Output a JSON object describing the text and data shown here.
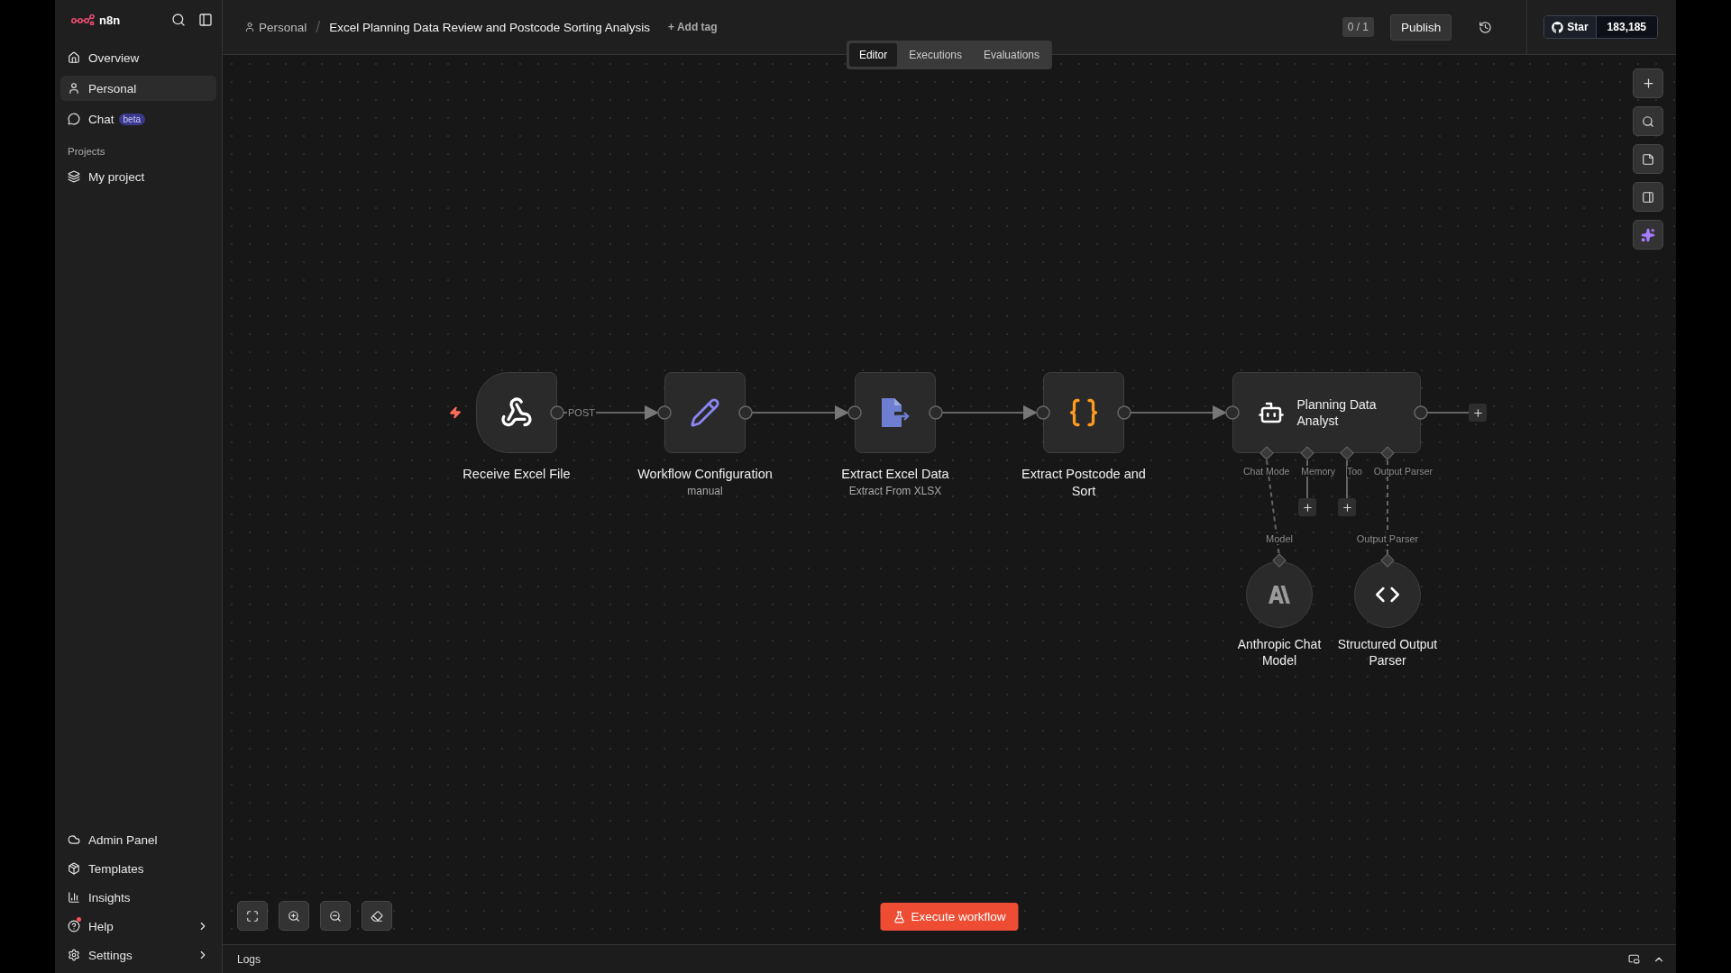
{
  "logo": {
    "text": "n8n"
  },
  "sidebar": {
    "items": [
      {
        "label": "Overview",
        "selected": false
      },
      {
        "label": "Personal",
        "selected": true
      },
      {
        "label": "Chat",
        "badge": "beta",
        "selected": false
      }
    ],
    "projects_heading": "Projects",
    "projects": [
      {
        "label": "My project"
      }
    ],
    "bottom_items": [
      {
        "label": "Admin Panel",
        "chevron": false,
        "notification": false
      },
      {
        "label": "Templates",
        "chevron": false,
        "notification": false
      },
      {
        "label": "Insights",
        "chevron": false,
        "notification": false
      },
      {
        "label": "Help",
        "chevron": true,
        "notification": true
      },
      {
        "label": "Settings",
        "chevron": true,
        "notification": false
      }
    ]
  },
  "header": {
    "breadcrumb": "Personal",
    "separator": "/",
    "title": "Excel Planning Data Review and Postcode Sorting Analysis",
    "add_tag": "+ Add tag",
    "counter": "0 / 1",
    "publish": "Publish",
    "github_star": "Star",
    "github_count": "183,185"
  },
  "tabs": [
    {
      "label": "Editor",
      "selected": true
    },
    {
      "label": "Executions",
      "selected": false
    },
    {
      "label": "Evaluations",
      "selected": false
    }
  ],
  "nodes": [
    {
      "kind": "trigger",
      "label": "Receive Excel File",
      "output_label": "POST"
    },
    {
      "kind": "action",
      "label": "Workflow Configuration",
      "subtitle": "manual"
    },
    {
      "kind": "action",
      "label": "Extract Excel Data",
      "subtitle": "Extract From XLSX"
    },
    {
      "kind": "action",
      "label": "Extract Postcode and Sort"
    },
    {
      "kind": "agent",
      "label": "Planning Data Analyst",
      "ports": [
        "Chat Mode",
        "Memory",
        "Too",
        "Output Parser"
      ]
    }
  ],
  "sub_nodes": [
    {
      "label": "Anthropic Chat Model",
      "port_label": "Model"
    },
    {
      "label": "Structured Output Parser",
      "port_label": "Output Parser"
    }
  ],
  "execute_button": "Execute workflow",
  "logs": {
    "label": "Logs"
  }
}
